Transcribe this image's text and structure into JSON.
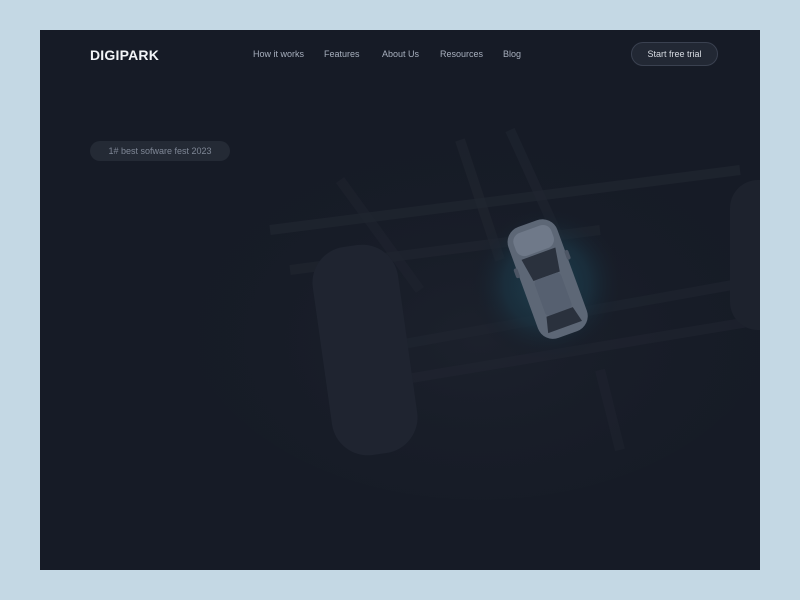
{
  "brand": {
    "logo_text": "DIGIPARK"
  },
  "nav": {
    "links": [
      {
        "label": "How it works"
      },
      {
        "label": "Features"
      },
      {
        "label": "About Us"
      },
      {
        "label": "Resources"
      },
      {
        "label": "Blog"
      }
    ],
    "cta_label": "Start free trial"
  },
  "hero": {
    "badge_text": "1# best sofware fest 2023",
    "scene_icon": "car-top-view-icon"
  },
  "colors": {
    "background": "#161b26",
    "page_outer": "#c4d8e4",
    "text_primary": "#f2f4f7",
    "text_muted": "#a7afbd",
    "car_glow": "#1f3c4d"
  }
}
